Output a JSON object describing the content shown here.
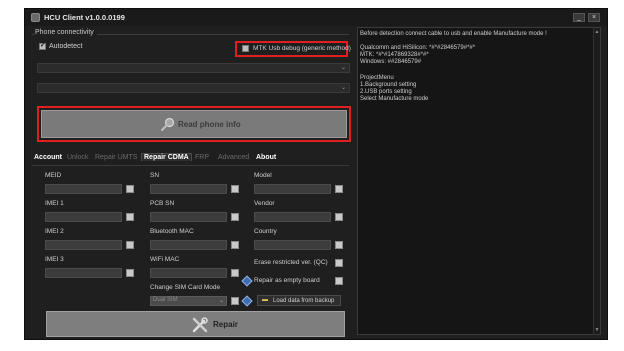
{
  "window": {
    "title": "HCU Client  v1.0.0.0199",
    "minimize_glyph": "_",
    "close_glyph": "×"
  },
  "connectivity": {
    "label": "Phone connectivity",
    "autodetect_label": "Autodetect",
    "autodetect_checked": true,
    "mtk_label": "MTK Usb debug (generic method)",
    "mtk_checked": false
  },
  "read_button": {
    "label": "Read phone info",
    "icon": "magnifier-icon"
  },
  "tabs": [
    {
      "label": "Account",
      "state": "normal"
    },
    {
      "label": "Unlock",
      "state": "disabled"
    },
    {
      "label": "Repair UMTS",
      "state": "disabled"
    },
    {
      "label": "Repair CDMA",
      "state": "active"
    },
    {
      "label": "FRP",
      "state": "disabled"
    },
    {
      "label": "Advanced",
      "state": "disabled"
    },
    {
      "label": "About",
      "state": "normal"
    }
  ],
  "fields": {
    "meid": "MEID",
    "imei1": "IMEI 1",
    "imei2": "IMEI 2",
    "imei3": "IMEI 3",
    "sn": "SN",
    "pcb_sn": "PCB SN",
    "bt_mac": "Bluetooth MAC",
    "wifi_mac": "WiFi MAC",
    "model": "Model",
    "vendor": "Vendor",
    "country": "Country"
  },
  "sim_mode": {
    "label": "Change SIM Card Mode",
    "selected": "Dual SIM"
  },
  "options": {
    "erase_restricted": "Erase restricted ver. (QC)",
    "repair_empty": "Repair as empty board"
  },
  "backup_button": {
    "label": "Load data from backup"
  },
  "repair_button": {
    "label": "Repair"
  },
  "log_lines": [
    "Before detection connect cable to usb and enable Manufacture mode !",
    "",
    "Qualcomm and HiSilicon: *#*#2846579#*#*",
    "MTK: *#*#147869328#*#*",
    "Windows: ##2846579#",
    "",
    "ProjectMenu",
    "1.Background setting",
    "2.USB ports setting",
    "Select Manufacture mode"
  ],
  "colors": {
    "highlight": "#e02020",
    "window_bg": "#1f1f1f"
  }
}
